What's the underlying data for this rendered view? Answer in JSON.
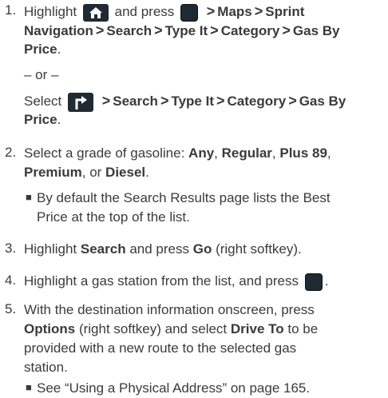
{
  "icons": {
    "home": "home-icon",
    "menu_key": "menu-key-icon",
    "navigate": "navigate-turn-icon",
    "ok_key": "ok-key-icon"
  },
  "separator": ">",
  "steps": [
    {
      "number": "1.",
      "line1_text": "Highlight",
      "line1_mid": "and press",
      "line1_b1": "Maps",
      "line1_b2": "Sprint",
      "line2_b1": "Navigation",
      "line2_b2": "Search",
      "line2_b3": "Type It",
      "line2_b4": "Category",
      "line2_b5": "Gas By",
      "line3_b1": "Price",
      "line3_end": ".",
      "or": "– or –",
      "alt_text": "Select",
      "alt_b1": "Search",
      "alt_b2": "Type It",
      "alt_b3": "Category",
      "alt_b4": "Gas By",
      "alt_line2_b1": "Price",
      "alt_line2_end": "."
    },
    {
      "number": "2.",
      "line1_text": "Select a grade of gasoline:",
      "b_any": "Any",
      "b_regular": "Regular",
      "b_plus": "Plus 89",
      "line2_b1": "Premium",
      "line2_mid": ", or",
      "line2_b2": "Diesel",
      "line2_end": ".",
      "bullet_line1": "By default the Search Results page lists the Best",
      "bullet_line2": "Price at the top of the list."
    },
    {
      "number": "3.",
      "t1": "Highlight",
      "b1": "Search",
      "t2": "and press",
      "b2": "Go",
      "t3": "(right softkey)."
    },
    {
      "number": "4.",
      "t1": "Highlight a gas station from the list, and press",
      "end": "."
    },
    {
      "number": "5.",
      "line1": "With the destination information onscreen, press",
      "line2_b1": "Options",
      "line2_t1": "(right softkey) and select",
      "line2_b2": "Drive To",
      "line2_t2": "to be",
      "line3": "provided with a new route to the selected gas",
      "line4": "station.",
      "bullet": "See “Using a Physical Address” on page 165."
    }
  ]
}
